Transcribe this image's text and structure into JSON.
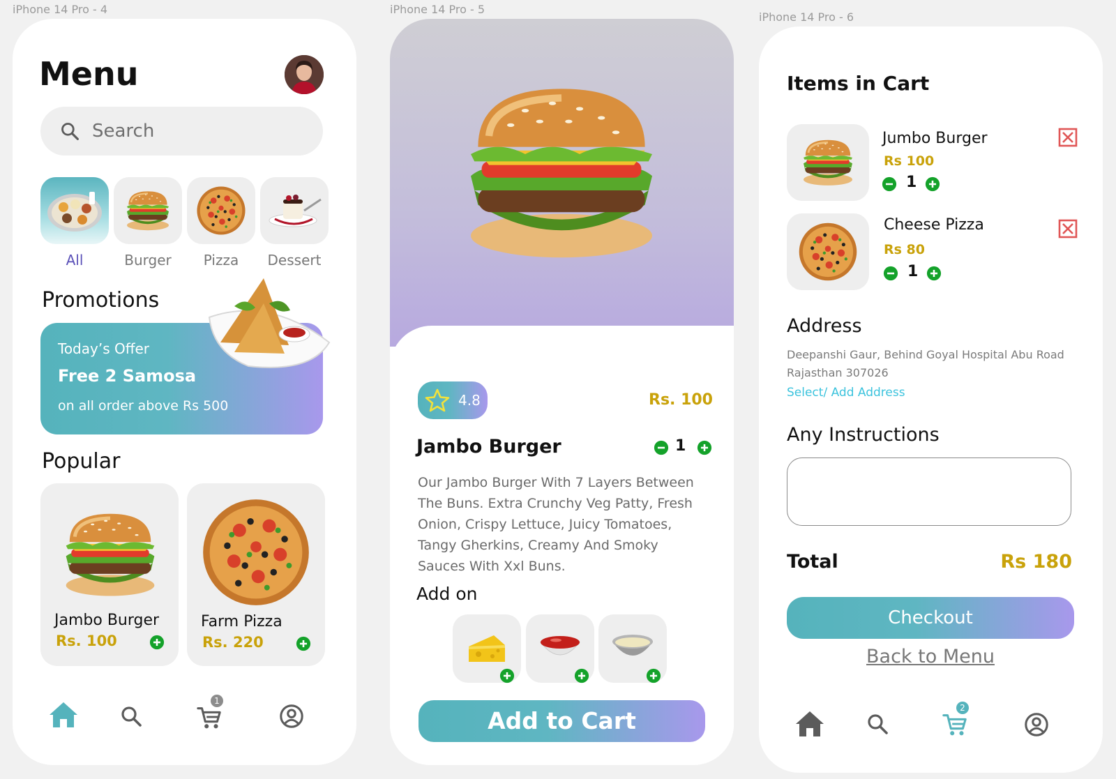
{
  "frames": {
    "menu": "iPhone 14 Pro - 4",
    "detail": "iPhone 14 Pro - 5",
    "cart": "iPhone 14 Pro - 6"
  },
  "menu": {
    "title": "Menu",
    "search_placeholder": "Search",
    "categories": [
      "All",
      "Burger",
      "Pizza",
      "Dessert"
    ],
    "promotions_title": "Promotions",
    "promo": {
      "heading": "Today’s Offer",
      "title": "Free 2  Samosa",
      "subtitle": "on all order above Rs 500"
    },
    "popular_title": "Popular",
    "popular": [
      {
        "name": "Jambo Burger",
        "price": "Rs. 100"
      },
      {
        "name": "Farm Pizza",
        "price": "Rs. 220"
      }
    ],
    "cart_badge": "1"
  },
  "detail": {
    "rating": "4.8",
    "price": "Rs. 100",
    "name": "Jambo Burger",
    "qty": "1",
    "description": "Our Jambo Burger With 7 Layers Between The Buns. Extra Crunchy Veg Patty, Fresh Onion, Crispy Lettuce,  Juicy Tomatoes, Tangy Gherkins, Creamy And Smoky Sauces With Xxl Buns.",
    "addon_title": "Add on",
    "addons": [
      "cheese",
      "ketchup",
      "mayonnaise"
    ],
    "add_to_cart": "Add to Cart"
  },
  "cart": {
    "title": "Items in Cart",
    "items": [
      {
        "name": "Jumbo Burger",
        "price": "Rs 100",
        "qty": "1"
      },
      {
        "name": "Cheese Pizza",
        "price": "Rs 80",
        "qty": "1"
      }
    ],
    "address_title": "Address",
    "address": "Deepanshi Gaur, Behind Goyal Hospital Abu Road Rajasthan 307026",
    "address_link": "Select/ Add Address",
    "instructions_title": "Any Instructions",
    "instructions_value": "",
    "total_label": "Total",
    "total_value": "Rs 180",
    "checkout": "Checkout",
    "back": "Back to Menu",
    "cart_badge": "2"
  },
  "colors": {
    "accent_teal": "#55b3bc",
    "accent_purple": "#a898ec",
    "price_gold": "#c9a20a",
    "green": "#14a22a",
    "link_cyan": "#3cc3dd",
    "remove_red": "#e05656"
  }
}
